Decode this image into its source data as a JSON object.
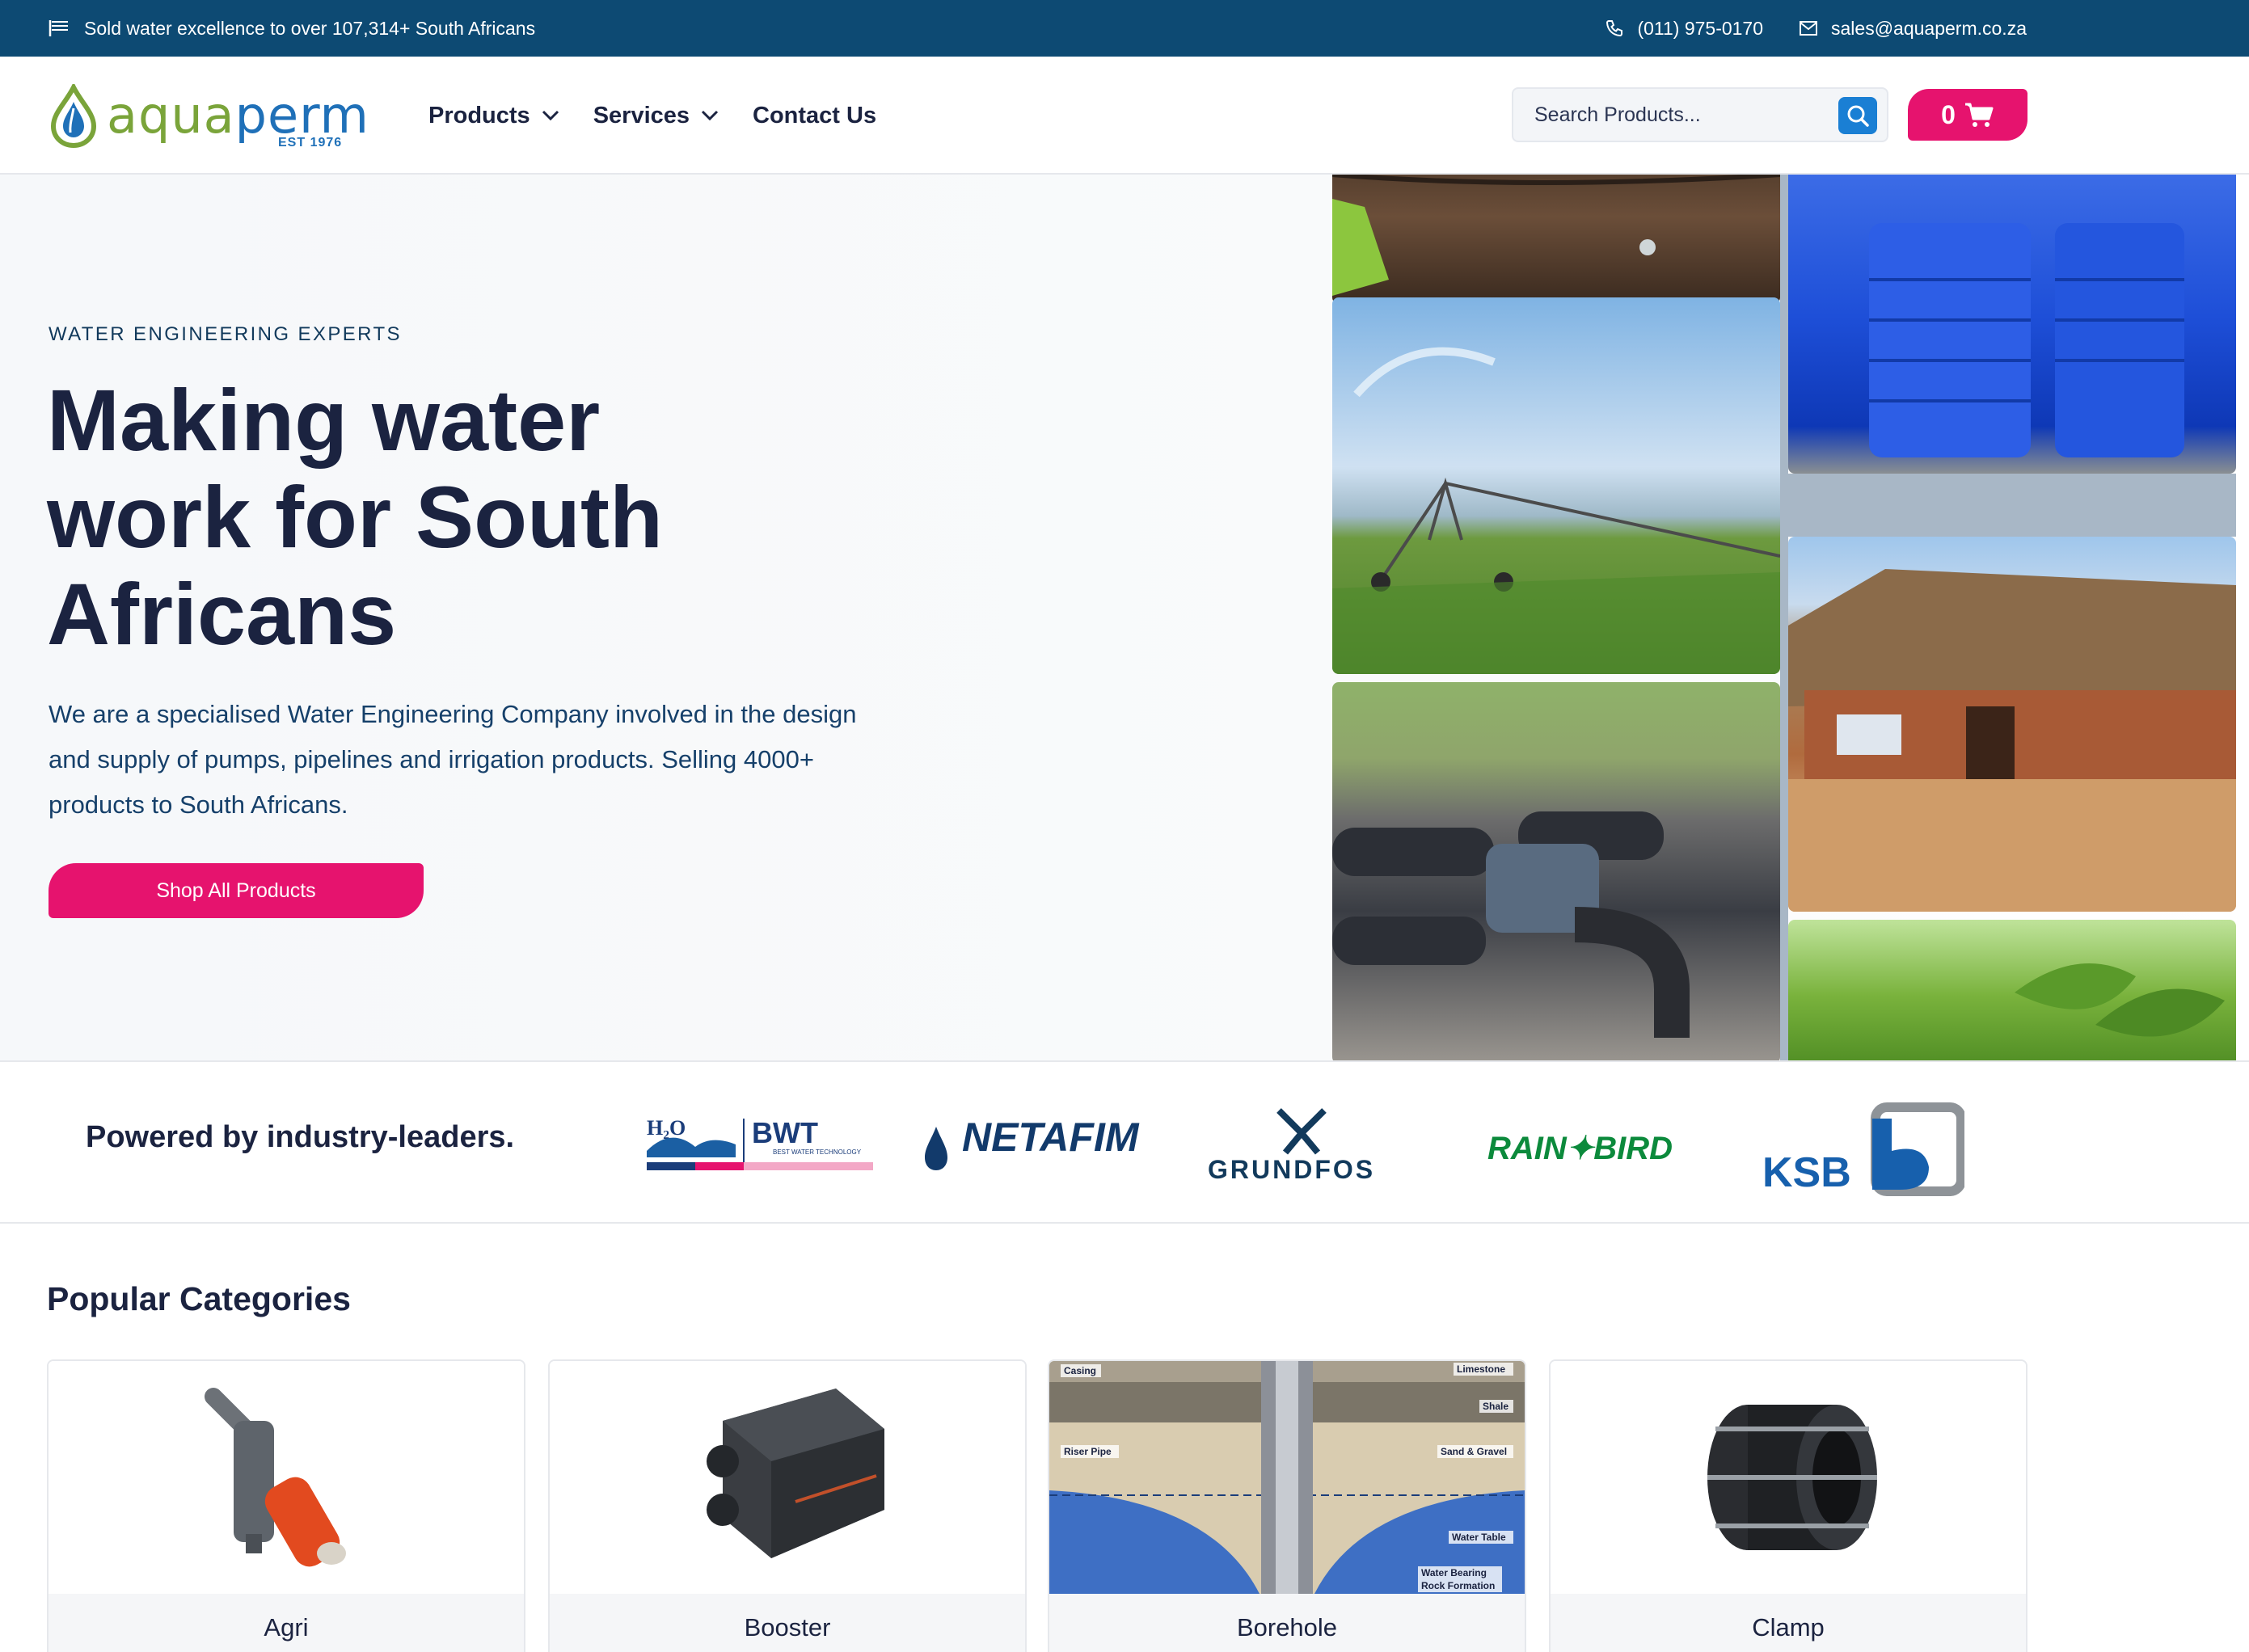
{
  "topbar": {
    "tagline": "Sold water excellence to over 107,314+ South Africans",
    "phone": "(011) 975-0170",
    "email": "sales@aquaperm.co.za"
  },
  "header": {
    "logo": {
      "word_a": "aqua",
      "word_b": "perm",
      "est": "EST 1976"
    },
    "nav": [
      {
        "label": "Products",
        "has_dropdown": true
      },
      {
        "label": "Services",
        "has_dropdown": true
      },
      {
        "label": "Contact Us",
        "has_dropdown": false
      }
    ],
    "search": {
      "placeholder": "Search Products..."
    },
    "cart": {
      "count": "0"
    }
  },
  "hero": {
    "eyebrow": "WATER ENGINEERING EXPERTS",
    "headline": "Making water work for South Africans",
    "description": "We are a specialised Water Engineering Company involved in the design and supply of pumps, pipelines and irrigation products. Selling 4000+ products to South Africans.",
    "cta": "Shop All Products"
  },
  "brands": {
    "title": "Powered by industry-leaders.",
    "logos": {
      "h2o": "H₂O",
      "bwt": "BWT",
      "bwt_sub": "BEST WATER TECHNOLOGY",
      "netafim": "NETAFIM",
      "grundfos": "GRUNDFOS",
      "rainbird": "RAIN✦BIRD",
      "ksb": "KSB"
    }
  },
  "categories": {
    "title": "Popular Categories",
    "items": [
      {
        "label": "Agri"
      },
      {
        "label": "Booster"
      },
      {
        "label": "Borehole",
        "diagram": {
          "casing": "Casing",
          "limestone": "Limestone",
          "shale": "Shale",
          "riser": "Riser Pipe",
          "sand": "Sand & Gravel",
          "table": "Water Table",
          "rock1": "Water Bearing",
          "rock2": "Rock Formation"
        }
      },
      {
        "label": "Clamp"
      }
    ]
  },
  "colors": {
    "topbar": "#0d4a73",
    "accent": "#e6136e",
    "search_button": "#1a7fd4",
    "heading": "#1b2340"
  }
}
